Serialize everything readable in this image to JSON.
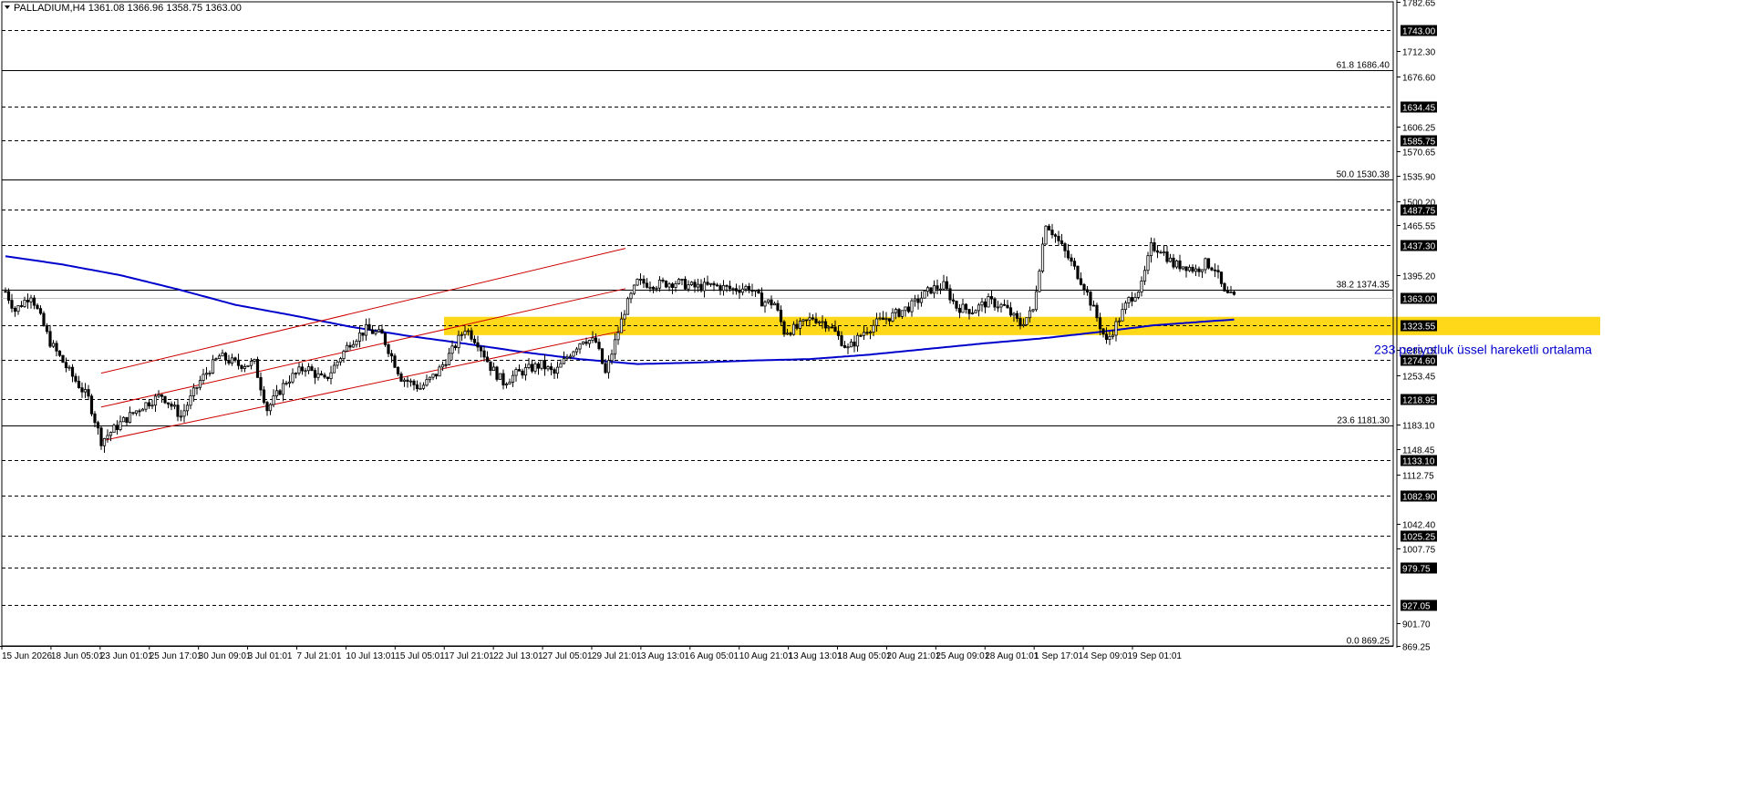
{
  "header": {
    "symbol": "PALLADIUM,H4",
    "ohlc": "1361.08 1366.96 1358.75 1363.00"
  },
  "colors": {
    "ema": "#0000cc",
    "zone": "#ffd400",
    "channel": "#cc0000",
    "candle": "#000000",
    "tag_bg": "#000000"
  },
  "chart_data": {
    "type": "line",
    "ylim": [
      869.25,
      1782.65
    ],
    "y_ticks": [
      {
        "value": 1782.65,
        "label": "1782.65"
      },
      {
        "value": 1712.3,
        "label": "1712.30"
      },
      {
        "value": 1676.6,
        "label": "1676.60"
      },
      {
        "value": 1606.25,
        "label": "1606.25"
      },
      {
        "value": 1570.65,
        "label": "1570.65"
      },
      {
        "value": 1535.9,
        "label": "1535.90"
      },
      {
        "value": 1500.2,
        "label": "1500.20"
      },
      {
        "value": 1465.55,
        "label": "1465.55"
      },
      {
        "value": 1395.2,
        "label": "1395.20"
      },
      {
        "value": 1289.15,
        "label": "1289.15"
      },
      {
        "value": 1253.45,
        "label": "1253.45"
      },
      {
        "value": 1183.1,
        "label": "1183.10"
      },
      {
        "value": 1148.45,
        "label": "1148.45"
      },
      {
        "value": 1112.75,
        "label": "1112.75"
      },
      {
        "value": 1042.4,
        "label": "1042.40"
      },
      {
        "value": 1007.75,
        "label": "1007.75"
      },
      {
        "value": 901.7,
        "label": "901.70"
      },
      {
        "value": 869.25,
        "label": "869.25"
      }
    ],
    "levels": [
      {
        "value": 1743.0,
        "label": "1743.00"
      },
      {
        "value": 1634.45,
        "label": "1634.45"
      },
      {
        "value": 1585.75,
        "label": "1585.75"
      },
      {
        "value": 1487.75,
        "label": "1487.75"
      },
      {
        "value": 1437.3,
        "label": "1437.30"
      },
      {
        "value": 1323.55,
        "label": "1323.55"
      },
      {
        "value": 1274.6,
        "label": "1274.60"
      },
      {
        "value": 1218.95,
        "label": "1218.95"
      },
      {
        "value": 1133.1,
        "label": "1133.10"
      },
      {
        "value": 1082.9,
        "label": "1082.90"
      },
      {
        "value": 1025.25,
        "label": "1025.25"
      },
      {
        "value": 979.75,
        "label": "979.75"
      },
      {
        "value": 927.05,
        "label": "927.05"
      }
    ],
    "current_price": {
      "value": 1363.0,
      "label": "1363.00"
    },
    "fib_levels": [
      {
        "value": 1686.4,
        "label": "61.8 1686.40"
      },
      {
        "value": 1530.38,
        "label": "50.0 1530.38"
      },
      {
        "value": 1374.35,
        "label": "38.2 1374.35"
      },
      {
        "value": 1181.3,
        "label": "23.6 1181.30"
      },
      {
        "value": 869.25,
        "label": "0.0 869.25"
      }
    ],
    "x_labels": [
      "15 Jun 2026",
      "18 Jun 05:01",
      "23 Jun 01:01",
      "25 Jun 17:01",
      "30 Jun 09:01",
      "3 Jul 01:01",
      "7 Jul 21:01",
      "10 Jul 13:01",
      "15 Jul 05:01",
      "17 Jul 21:01",
      "22 Jul 13:01",
      "27 Jul 05:01",
      "29 Jul 21:01",
      "3 Aug 13:01",
      "6 Aug 05:01",
      "10 Aug 21:01",
      "13 Aug 13:01",
      "18 Aug 05:01",
      "20 Aug 21:01",
      "25 Aug 09:01",
      "28 Aug 01:01",
      "1 Sep 17:01",
      "4 Sep 09:01",
      "9 Sep 01:01"
    ],
    "zone": {
      "from": 1310,
      "to": 1336
    },
    "price_path": [
      [
        0,
        1372
      ],
      [
        3,
        1345
      ],
      [
        8,
        1368
      ],
      [
        14,
        1300
      ],
      [
        20,
        1258
      ],
      [
        26,
        1220
      ],
      [
        30,
        1160
      ],
      [
        36,
        1185
      ],
      [
        43,
        1210
      ],
      [
        49,
        1225
      ],
      [
        55,
        1195
      ],
      [
        61,
        1245
      ],
      [
        67,
        1280
      ],
      [
        73,
        1268
      ],
      [
        78,
        1270
      ],
      [
        82,
        1205
      ],
      [
        88,
        1245
      ],
      [
        94,
        1265
      ],
      [
        100,
        1245
      ],
      [
        108,
        1300
      ],
      [
        113,
        1318
      ],
      [
        118,
        1310
      ],
      [
        124,
        1250
      ],
      [
        130,
        1235
      ],
      [
        135,
        1255
      ],
      [
        140,
        1288
      ],
      [
        144,
        1320
      ],
      [
        148,
        1300
      ],
      [
        152,
        1265
      ],
      [
        156,
        1243
      ],
      [
        160,
        1255
      ],
      [
        164,
        1262
      ],
      [
        168,
        1268
      ],
      [
        172,
        1255
      ],
      [
        177,
        1285
      ],
      [
        181,
        1305
      ],
      [
        185,
        1300
      ],
      [
        188,
        1255
      ],
      [
        194,
        1345
      ],
      [
        198,
        1385
      ],
      [
        204,
        1382
      ],
      [
        210,
        1385
      ],
      [
        216,
        1378
      ],
      [
        222,
        1380
      ],
      [
        228,
        1375
      ],
      [
        233,
        1378
      ],
      [
        237,
        1358
      ],
      [
        241,
        1355
      ],
      [
        244,
        1315
      ],
      [
        248,
        1320
      ],
      [
        253,
        1335
      ],
      [
        258,
        1325
      ],
      [
        264,
        1290
      ],
      [
        269,
        1315
      ],
      [
        274,
        1330
      ],
      [
        279,
        1340
      ],
      [
        284,
        1352
      ],
      [
        290,
        1375
      ],
      [
        294,
        1380
      ],
      [
        298,
        1350
      ],
      [
        303,
        1345
      ],
      [
        308,
        1358
      ],
      [
        313,
        1350
      ],
      [
        318,
        1325
      ],
      [
        322,
        1345
      ],
      [
        326,
        1470
      ],
      [
        329,
        1450
      ],
      [
        333,
        1420
      ],
      [
        338,
        1380
      ],
      [
        342,
        1335
      ],
      [
        345,
        1300
      ],
      [
        348,
        1325
      ],
      [
        352,
        1360
      ],
      [
        356,
        1380
      ],
      [
        359,
        1435
      ],
      [
        362,
        1432
      ],
      [
        366,
        1410
      ],
      [
        370,
        1408
      ],
      [
        373,
        1402
      ],
      [
        376,
        1412
      ],
      [
        379,
        1405
      ],
      [
        382,
        1368
      ],
      [
        385,
        1363
      ]
    ],
    "ema_path": [
      [
        0,
        1422
      ],
      [
        18,
        1410
      ],
      [
        36,
        1395
      ],
      [
        54,
        1375
      ],
      [
        72,
        1353
      ],
      [
        90,
        1338
      ],
      [
        108,
        1322
      ],
      [
        126,
        1309
      ],
      [
        144,
        1298
      ],
      [
        162,
        1286
      ],
      [
        180,
        1276
      ],
      [
        198,
        1269
      ],
      [
        216,
        1271
      ],
      [
        234,
        1274
      ],
      [
        252,
        1276
      ],
      [
        270,
        1282
      ],
      [
        288,
        1290
      ],
      [
        306,
        1298
      ],
      [
        324,
        1305
      ],
      [
        342,
        1314
      ],
      [
        360,
        1324
      ],
      [
        378,
        1330
      ],
      [
        385,
        1332
      ]
    ],
    "channel": [
      {
        "x1": 30,
        "y1": 1256,
        "x2": 120,
        "y2": 1353
      },
      {
        "x1": 30,
        "y1": 1208,
        "x2": 120,
        "y2": 1300
      },
      {
        "x1": 30,
        "y1": 1160,
        "x2": 120,
        "y2": 1246
      }
    ]
  },
  "annotation": {
    "ema_note": "233 periyotluk üssel hareketli ortalama"
  }
}
